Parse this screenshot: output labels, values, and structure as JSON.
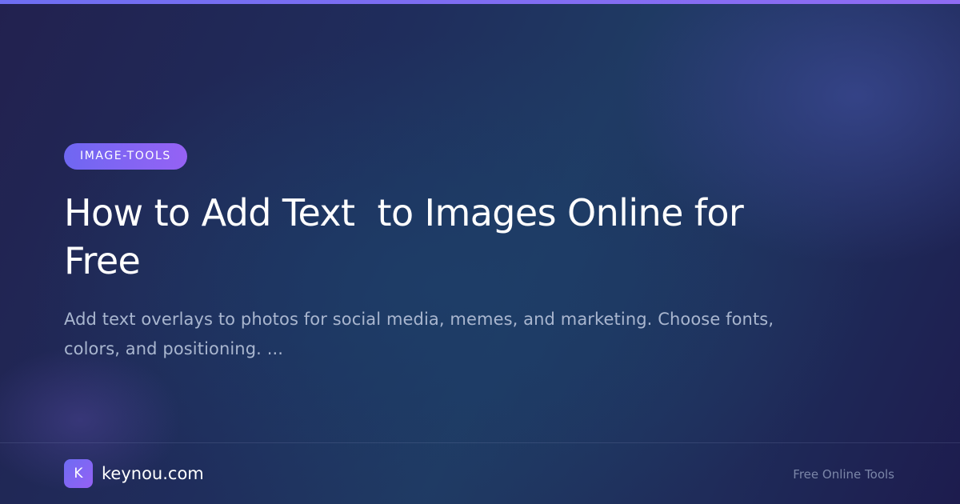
{
  "badge": {
    "label": "IMAGE-TOOLS"
  },
  "article": {
    "title": "How to Add Text  to Images Online for Free",
    "description": "Add text overlays to photos for social media, memes, and marketing. Choose fonts, colors, and positioning. ..."
  },
  "footer": {
    "logo_letter": "K",
    "site_name": "keynou.com",
    "tagline": "Free Online Tools"
  },
  "colors": {
    "accent": "#7b68f3",
    "background": "#1f2d5c",
    "title_text": "#ffffff",
    "description_text": "#a9b6cf",
    "tagline_text": "#7b86a8"
  }
}
